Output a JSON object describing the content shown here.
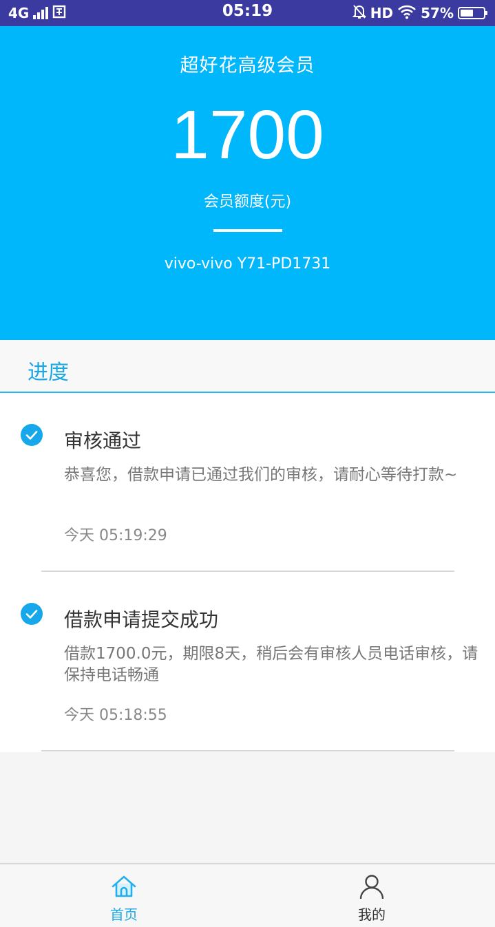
{
  "status_bar": {
    "network": "4G",
    "time": "05:19",
    "hd": "HD",
    "battery_text": "57%",
    "battery_level": 0.57
  },
  "hero": {
    "title": "超好花高级会员",
    "amount": "1700",
    "unit": "会员额度(元)",
    "device": "vivo-vivo Y71-PD1731"
  },
  "progress": {
    "title": "进度",
    "steps": [
      {
        "title": "审核通过",
        "desc": "恭喜您，借款申请已通过我们的审核，请耐心等待打款~",
        "time": "今天 05:19:29"
      },
      {
        "title": "借款申请提交成功",
        "desc": "借款1700.0元，期限8天，稍后会有审核人员电话审核，请保持电话畅通",
        "time": "今天 05:18:55"
      }
    ]
  },
  "tabbar": {
    "home": "首页",
    "mine": "我的"
  },
  "colors": {
    "accent": "#00b7fb",
    "status_bar": "#3a3aa0",
    "check": "#16a8ea"
  }
}
